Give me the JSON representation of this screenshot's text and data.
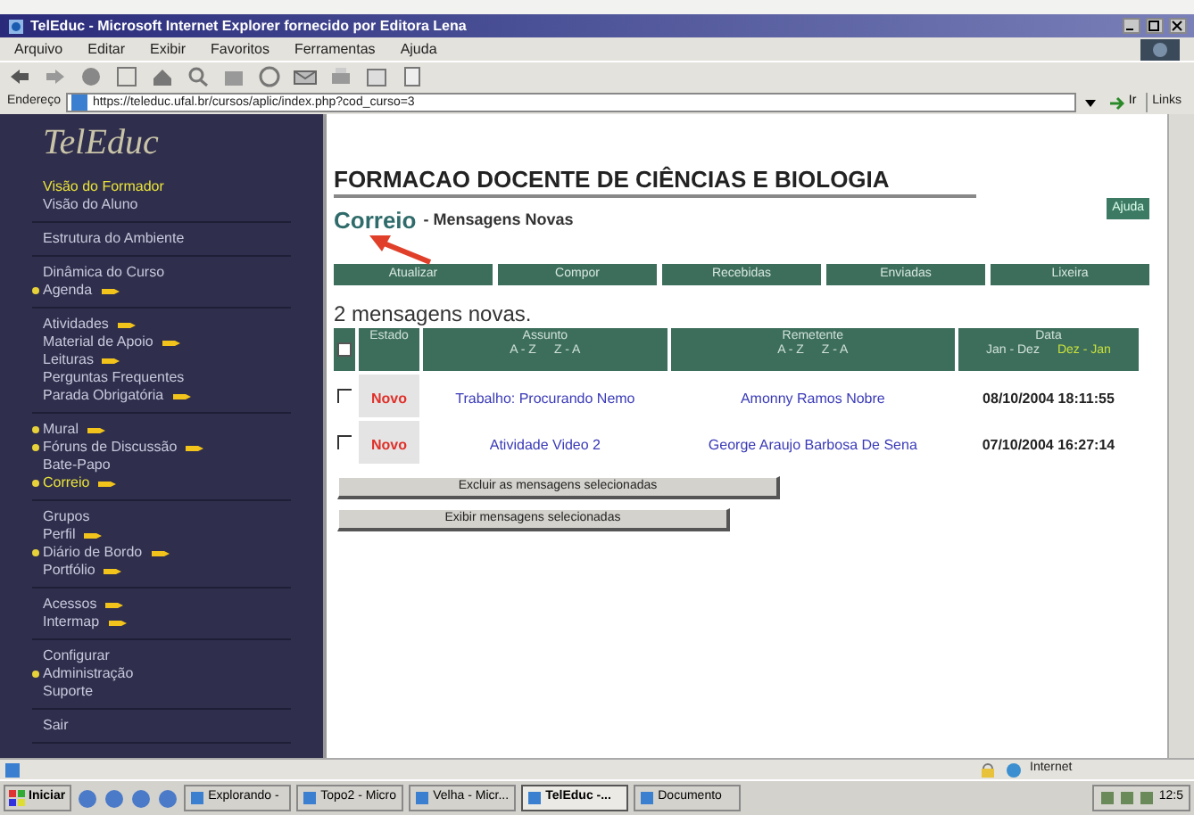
{
  "window": {
    "title": "TelEduc - Microsoft Internet Explorer fornecido por Editora Lena"
  },
  "menu": [
    "Arquivo",
    "Editar",
    "Exibir",
    "Favoritos",
    "Ferramentas",
    "Ajuda"
  ],
  "address_bar": {
    "label": "Endereço",
    "value": "https://teleduc.ufal.br/cursos/aplic/index.php?cod_curso=3",
    "go": "Ir",
    "links": "Links"
  },
  "sidebar": {
    "logo": "TelEduc",
    "groups": [
      [
        {
          "label": "Visão do Formador",
          "bullet": false,
          "pointer": false,
          "selected": true
        },
        {
          "label": "Visão do Aluno",
          "bullet": false,
          "pointer": false,
          "selected": false
        }
      ],
      [
        {
          "label": "Estrutura do Ambiente",
          "bullet": false,
          "pointer": false,
          "selected": false
        }
      ],
      [
        {
          "label": "Dinâmica do Curso",
          "bullet": false,
          "pointer": false,
          "selected": false
        },
        {
          "label": "Agenda",
          "bullet": true,
          "pointer": true,
          "selected": false
        }
      ],
      [
        {
          "label": "Atividades",
          "bullet": false,
          "pointer": true,
          "selected": false
        },
        {
          "label": "Material de Apoio",
          "bullet": false,
          "pointer": true,
          "selected": false
        },
        {
          "label": "Leituras",
          "bullet": false,
          "pointer": true,
          "selected": false
        },
        {
          "label": "Perguntas Frequentes",
          "bullet": false,
          "pointer": false,
          "selected": false
        },
        {
          "label": "Parada Obrigatória",
          "bullet": false,
          "pointer": true,
          "selected": false
        }
      ],
      [
        {
          "label": "Mural",
          "bullet": true,
          "pointer": true,
          "selected": false
        },
        {
          "label": "Fóruns de Discussão",
          "bullet": true,
          "pointer": true,
          "selected": false
        },
        {
          "label": "Bate-Papo",
          "bullet": false,
          "pointer": false,
          "selected": false
        },
        {
          "label": "Correio",
          "bullet": true,
          "pointer": true,
          "selected": true
        }
      ],
      [
        {
          "label": "Grupos",
          "bullet": false,
          "pointer": false,
          "selected": false
        },
        {
          "label": "Perfil",
          "bullet": false,
          "pointer": true,
          "selected": false
        },
        {
          "label": "Diário de Bordo",
          "bullet": true,
          "pointer": true,
          "selected": false
        },
        {
          "label": "Portfólio",
          "bullet": false,
          "pointer": true,
          "selected": false
        }
      ],
      [
        {
          "label": "Acessos",
          "bullet": false,
          "pointer": true,
          "selected": false
        },
        {
          "label": "Intermap",
          "bullet": false,
          "pointer": true,
          "selected": false
        }
      ],
      [
        {
          "label": "Configurar",
          "bullet": false,
          "pointer": false,
          "selected": false
        },
        {
          "label": "Administração",
          "bullet": true,
          "pointer": false,
          "selected": false
        },
        {
          "label": "Suporte",
          "bullet": false,
          "pointer": false,
          "selected": false
        }
      ],
      [
        {
          "label": "Sair",
          "bullet": false,
          "pointer": false,
          "selected": false
        }
      ]
    ]
  },
  "course_title": "FORMACAO DOCENTE DE CIÊNCIAS E BIOLOGIA",
  "tool_title": "Correio",
  "subtitle": "- Mensagens Novas",
  "help_button": "Ajuda",
  "tabs": [
    "Atualizar",
    "Compor",
    "Recebidas",
    "Enviadas",
    "Lixeira"
  ],
  "summary": "2 mensagens novas.",
  "table": {
    "header_checkbox": {
      "checked": false
    },
    "columns": [
      {
        "label": "Estado"
      },
      {
        "label": "Assunto",
        "sorts": [
          {
            "label": "A - Z",
            "selected": false
          },
          {
            "label": "Z - A",
            "selected": false
          }
        ]
      },
      {
        "label": "Remetente",
        "sorts": [
          {
            "label": "A - Z",
            "selected": false
          },
          {
            "label": "Z - A",
            "selected": false
          }
        ]
      },
      {
        "label": "Data",
        "sorts": [
          {
            "label": "Jan - Dez",
            "selected": false
          },
          {
            "label": "Dez - Jan",
            "selected": true
          }
        ]
      }
    ],
    "rows": [
      {
        "checked": false,
        "status": "Novo",
        "subject": "Trabalho: Procurando Nemo",
        "sender": "Amonny Ramos Nobre",
        "date": "08/10/2004 18:11:55"
      },
      {
        "checked": false,
        "status": "Novo",
        "subject": "Atividade Video 2",
        "sender": "George Araujo Barbosa De Sena",
        "date": "07/10/2004 16:27:14"
      }
    ]
  },
  "actions": [
    "Excluir as mensagens selecionadas",
    "Exibir mensagens selecionadas"
  ],
  "status_bar": {
    "zone": "Internet"
  },
  "taskbar": {
    "start": "Iniciar",
    "tasks": [
      {
        "label": "Explorando -",
        "selected": false
      },
      {
        "label": "Topo2 - Micro",
        "selected": false
      },
      {
        "label": "Velha - Micr...",
        "selected": false
      },
      {
        "label": "TelEduc -...",
        "selected": true
      },
      {
        "label": "Documento",
        "selected": false
      }
    ],
    "clock": "12:5"
  }
}
